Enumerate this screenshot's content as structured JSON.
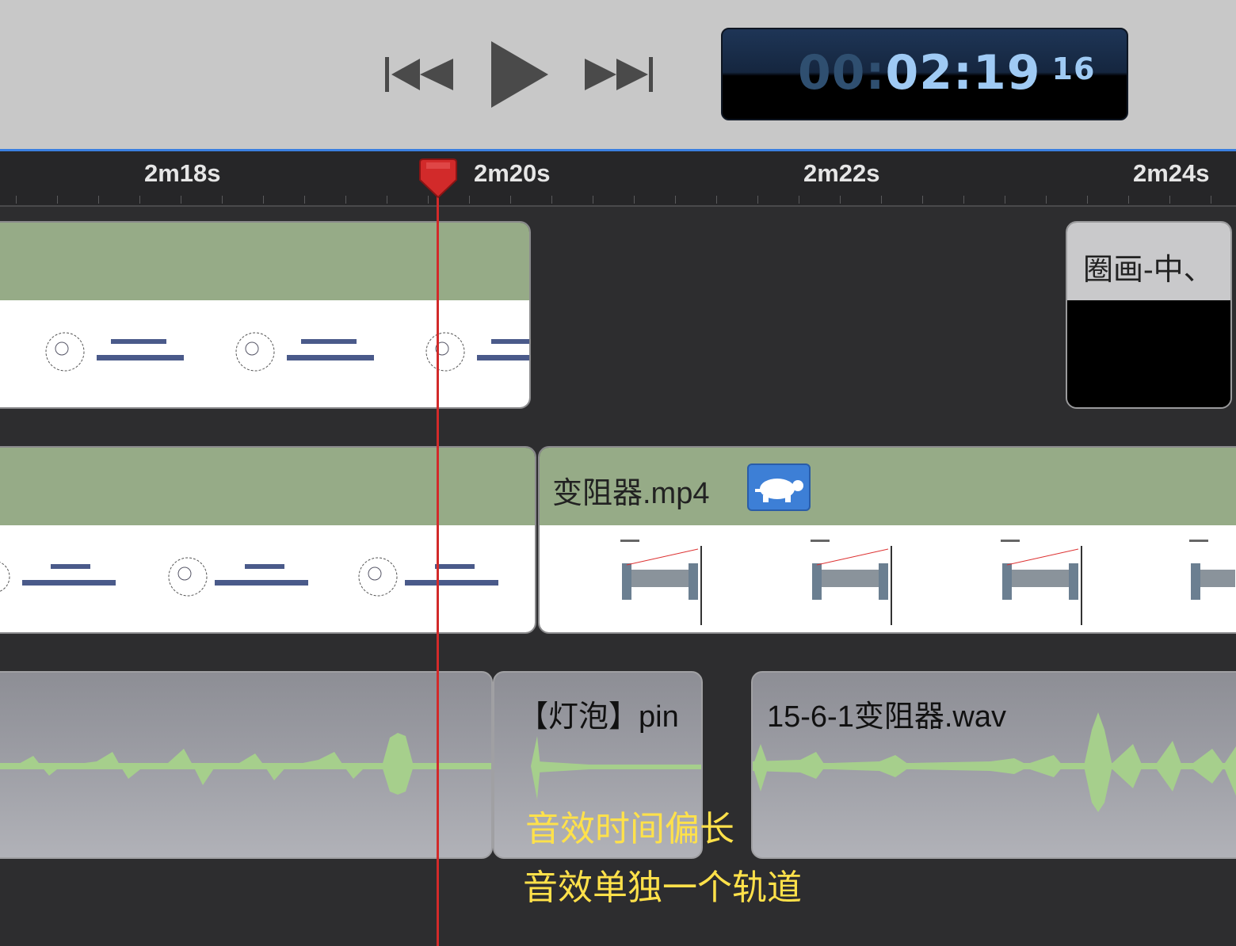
{
  "transport": {
    "rewind_label": "Rewind",
    "play_label": "Play",
    "forward_label": "Fast forward"
  },
  "timecode": {
    "hours_prefix": "00:",
    "main": "02:19",
    "frames": "16"
  },
  "ruler": {
    "ticks": [
      "2m18s",
      "2m20s",
      "2m22s",
      "2m24s"
    ]
  },
  "video_track_1": {
    "clip_right_title": "圈画-中、"
  },
  "video_track_2": {
    "clip_title": "变阻器.mp4",
    "speed_badge": "turtle-icon"
  },
  "audio_track": {
    "clip_a_title": "【灯泡】pin",
    "clip_b_title": "15-6-1变阻器.wav"
  },
  "annotations": {
    "line1": "音效时间偏长",
    "line2": "音效单独一个轨道"
  },
  "colors": {
    "playhead": "#d22a2a",
    "clip_header": "#96ab87",
    "timecode_digits": "#9fcaf4",
    "annotation": "#ffe14a",
    "waveform": "#a6cf8c",
    "accent_line": "#3a7fe0"
  }
}
